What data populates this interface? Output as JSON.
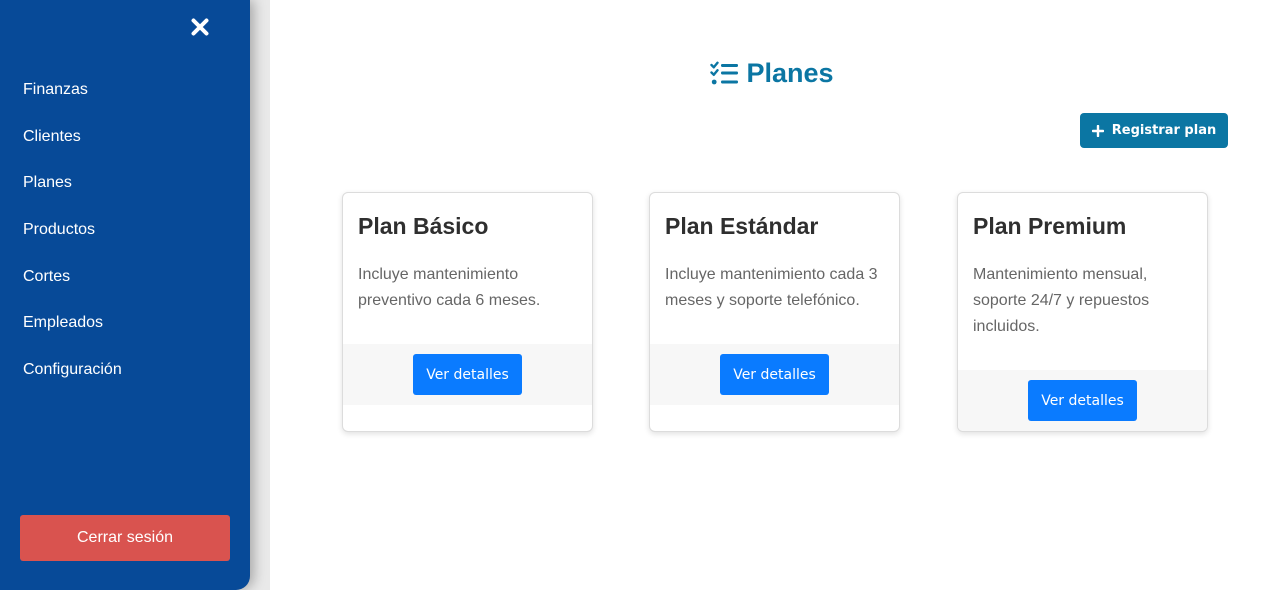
{
  "sidebar": {
    "close_icon": "close-x-icon",
    "items": [
      {
        "label": "Finanzas"
      },
      {
        "label": "Clientes"
      },
      {
        "label": "Planes"
      },
      {
        "label": "Productos"
      },
      {
        "label": "Cortes"
      },
      {
        "label": "Empleados"
      },
      {
        "label": "Configuración"
      }
    ],
    "logout_label": "Cerrar sesión"
  },
  "main": {
    "title": "Planes",
    "title_icon": "list-check-icon",
    "register_label": "Registrar plan",
    "register_icon": "plus-icon",
    "cards": [
      {
        "title": "Plan Básico",
        "description": "Incluye mantenimiento preventivo cada 6 meses.",
        "button_label": "Ver detalles"
      },
      {
        "title": "Plan Estándar",
        "description": "Incluye mantenimiento cada 3 meses y soporte telefónico.",
        "button_label": "Ver detalles"
      },
      {
        "title": "Plan Premium",
        "description": "Mantenimiento mensual, soporte 24/7 y repuestos incluidos.",
        "button_label": "Ver detalles"
      }
    ]
  },
  "colors": {
    "sidebar_bg": "#074a98",
    "accent": "#0b76a3",
    "logout": "#d9534f",
    "details_button": "#0a7bff"
  }
}
